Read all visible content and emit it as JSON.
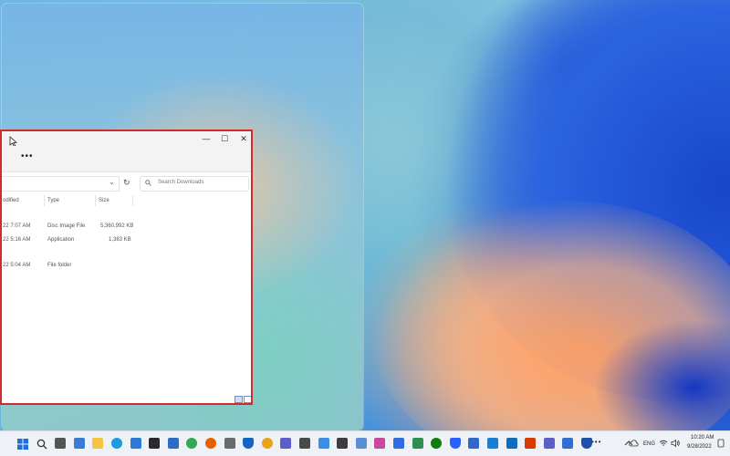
{
  "explorer": {
    "more_label": "•••",
    "search_placeholder": "Search Downloads",
    "columns": [
      "odified",
      "Type",
      "Size"
    ],
    "rows": [
      {
        "date": "22 7:07 AM",
        "type": "Disc Image File",
        "size": "5,360,992 KB"
      },
      {
        "date": "22 5:16 AM",
        "type": "Application",
        "size": "1,383 KB"
      },
      {
        "date": "22 5:04 AM",
        "type": "File folder",
        "size": ""
      }
    ],
    "controls": {
      "minimize": "—",
      "maximize": "☐",
      "close": "✕",
      "refresh": "↻",
      "dropdown": "⌄"
    }
  },
  "taskbar": {
    "icons": [
      {
        "name": "start",
        "color": "#1e6fd9"
      },
      {
        "name": "search",
        "color": "#333333"
      },
      {
        "name": "task-view",
        "color": "#555555"
      },
      {
        "name": "widgets",
        "color": "#3a7bd5"
      },
      {
        "name": "file-explorer",
        "color": "#f4c542"
      },
      {
        "name": "edge",
        "color": "#1b9be0"
      },
      {
        "name": "store",
        "color": "#2d7ad6"
      },
      {
        "name": "terminal",
        "color": "#2b2b2b"
      },
      {
        "name": "photos",
        "color": "#2b6cc4"
      },
      {
        "name": "chrome",
        "color": "#34a853"
      },
      {
        "name": "firefox",
        "color": "#e66000"
      },
      {
        "name": "settings",
        "color": "#6b6b6b"
      },
      {
        "name": "shield",
        "color": "#1565c0"
      },
      {
        "name": "edge-canary",
        "color": "#e8a317"
      },
      {
        "name": "teams",
        "color": "#5b5fc7"
      },
      {
        "name": "camera",
        "color": "#4a4a4a"
      },
      {
        "name": "news",
        "color": "#3a8ee6"
      },
      {
        "name": "calculator",
        "color": "#3d3d3d"
      },
      {
        "name": "notepad",
        "color": "#5a8fd6"
      },
      {
        "name": "paint",
        "color": "#c94a9c"
      },
      {
        "name": "todo",
        "color": "#2f6de0"
      },
      {
        "name": "check",
        "color": "#2f8f4e"
      },
      {
        "name": "xbox",
        "color": "#107c10"
      },
      {
        "name": "security",
        "color": "#2962ff"
      },
      {
        "name": "maps",
        "color": "#3069c9"
      },
      {
        "name": "photos-2",
        "color": "#1a7fd4"
      },
      {
        "name": "mail",
        "color": "#0f6cbd"
      },
      {
        "name": "office",
        "color": "#d83b01"
      },
      {
        "name": "clipchamp",
        "color": "#5b5fc7"
      },
      {
        "name": "remote",
        "color": "#2e6fd1"
      },
      {
        "name": "defender",
        "color": "#1f4fa8"
      }
    ],
    "overflow_label": "•••",
    "language": "ENG",
    "time": "10:20 AM",
    "date": "9/28/2022"
  }
}
